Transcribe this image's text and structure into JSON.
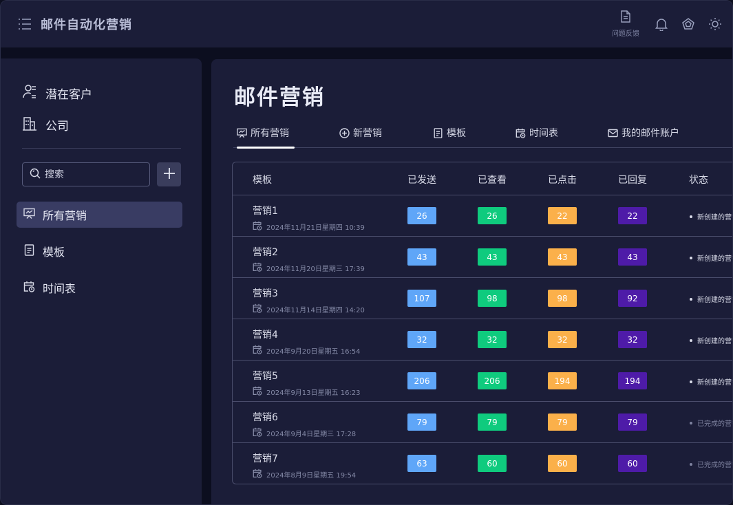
{
  "app": {
    "title": "邮件自动化营销",
    "feedback_label": "问题反馈"
  },
  "colors": {
    "sent": "#5fa6f8",
    "viewed": "#0fcb7e",
    "clicked": "#fbb04a",
    "replied": "#4e1ba8",
    "status_new": "#d9dbe8",
    "status_done": "#7e829f"
  },
  "sidebar": {
    "top_items": [
      {
        "label": "潜在客户",
        "icon": "user-list-icon"
      },
      {
        "label": "公司",
        "icon": "building-icon"
      }
    ],
    "search": {
      "placeholder": "搜索"
    },
    "menu": [
      {
        "label": "所有营销",
        "icon": "presentation-chart-icon",
        "active": true
      },
      {
        "label": "模板",
        "icon": "document-icon",
        "active": false
      },
      {
        "label": "时间表",
        "icon": "calendar-clock-icon",
        "active": false
      }
    ]
  },
  "main": {
    "title": "邮件营销",
    "tabs": [
      {
        "label": "所有营销",
        "icon": "presentation-chart-icon"
      },
      {
        "label": "新营销",
        "icon": "plus-circle-icon"
      },
      {
        "label": "模板",
        "icon": "document-icon"
      },
      {
        "label": "时间表",
        "icon": "calendar-clock-icon"
      },
      {
        "label": "我的邮件账户",
        "icon": "mail-icon"
      }
    ],
    "table": {
      "headers": {
        "template": "模板",
        "sent": "已发送",
        "viewed": "已查看",
        "clicked": "已点击",
        "replied": "已回复",
        "status": "状态"
      },
      "rows": [
        {
          "name": "营销1",
          "date": "2024年11月21日星期四 10:39",
          "sent": "26",
          "viewed": "26",
          "clicked": "22",
          "replied": "22",
          "status": "新创建的营销",
          "status_type": "new"
        },
        {
          "name": "营销2",
          "date": "2024年11月20日星期三 17:39",
          "sent": "43",
          "viewed": "43",
          "clicked": "43",
          "replied": "43",
          "status": "新创建的营销",
          "status_type": "new"
        },
        {
          "name": "营销3",
          "date": "2024年11月14日星期四 14:20",
          "sent": "107",
          "viewed": "98",
          "clicked": "98",
          "replied": "92",
          "status": "新创建的营销",
          "status_type": "new"
        },
        {
          "name": "营销4",
          "date": "2024年9月20日星期五 16:54",
          "sent": "32",
          "viewed": "32",
          "clicked": "32",
          "replied": "32",
          "status": "新创建的营销",
          "status_type": "new"
        },
        {
          "name": "营销5",
          "date": "2024年9月13日星期五 16:23",
          "sent": "206",
          "viewed": "206",
          "clicked": "194",
          "replied": "194",
          "status": "新创建的营销",
          "status_type": "new"
        },
        {
          "name": "营销6",
          "date": "2024年9月4日星期三 17:28",
          "sent": "79",
          "viewed": "79",
          "clicked": "79",
          "replied": "79",
          "status": "已完成的营销",
          "status_type": "done"
        },
        {
          "name": "营销7",
          "date": "2024年8月9日星期五 19:54",
          "sent": "63",
          "viewed": "60",
          "clicked": "60",
          "replied": "60",
          "status": "已完成的营销",
          "status_type": "done"
        }
      ]
    }
  }
}
